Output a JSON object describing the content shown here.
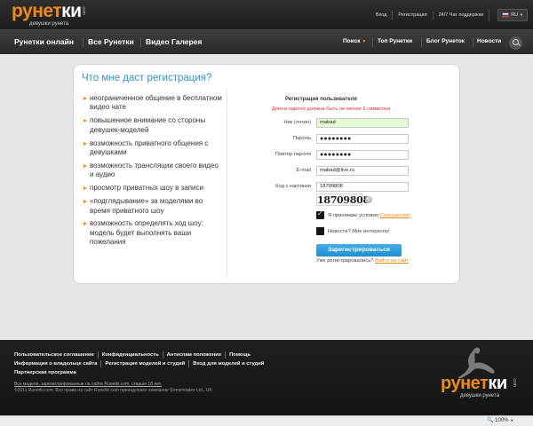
{
  "header": {
    "logo_part1": "рунет",
    "logo_part2": "ки",
    "logo_domain": ".com",
    "logo_tagline": "девушки рунета",
    "links": [
      "Вход",
      "Регистрация",
      "24/7 Чат поддержки"
    ],
    "language": "RU"
  },
  "nav": {
    "left": [
      "Рунетки онлайн",
      "Все Рунетки",
      "Видео Галерея"
    ],
    "right": [
      "Поиск",
      "Топ Рунетки",
      "Блог Рунеток",
      "Новости"
    ]
  },
  "card": {
    "title": "Что мне даст регистрация?",
    "benefits": [
      "неограниченное общение в бесплатном видео чате",
      "повышенное внимание со стороны девушек-моделей",
      "возможность приватного общения с девушками",
      "возможность трансляции своего видео и аудио",
      "просмотр приватных шоу в записи",
      "«подглядывание» за моделями во время приватного шоу",
      "возможность определять ход шоу: модель будет выполнять ваши пожелания"
    ]
  },
  "form": {
    "title": "Регистрация пользователя",
    "error": "Длина пароля должна быть не менее 5 символов",
    "fields": [
      {
        "label": "Ник (логин)",
        "value": "mabad"
      },
      {
        "label": "Пароль",
        "value": "●●●●●●●●"
      },
      {
        "label": "Повтор пароля",
        "value": "●●●●●●●●"
      },
      {
        "label": "E-mail",
        "value": "mabad@live.ru"
      },
      {
        "label": "Код с картинки",
        "value": "18709808"
      }
    ],
    "captcha_text": "18709808",
    "terms_prefix": "Я принимаю условия",
    "terms_link": "Соглашения",
    "terms_checked": true,
    "news_label": "Новости? Мне интересно!",
    "news_checked": false,
    "submit_label": "Зарегистрироваться",
    "already_text": "Уже регистрировались?",
    "login_link": "Войти на сайт"
  },
  "footer": {
    "row1": [
      "Пользовательское соглашение",
      "Конфиденциальность",
      "Антиспам положение",
      "Помощь"
    ],
    "row2": [
      "Информация о владельце сайта",
      "Регистрация моделей и студий",
      "Вход для моделей и студий"
    ],
    "row3": [
      "Партнерская программа"
    ],
    "note_link": "Все модели, зарегистрированные на сайте Runetki.com, старше 18 лет.",
    "copyright": "©2011 Runetki.com. Все права на сайт Runetki.com принадлежат компании Streamdates Ltd., UK",
    "logo_part1": "рунет",
    "logo_part2": "ки",
    "logo_domain": ".com",
    "logo_tagline": "девушки рунета"
  },
  "statusbar": {
    "zoom": "100%"
  },
  "colors": {
    "accent": "#f08b12",
    "title_blue": "#2f95d2",
    "error_red": "#e0302c",
    "button_blue": "#1e8ed3"
  }
}
